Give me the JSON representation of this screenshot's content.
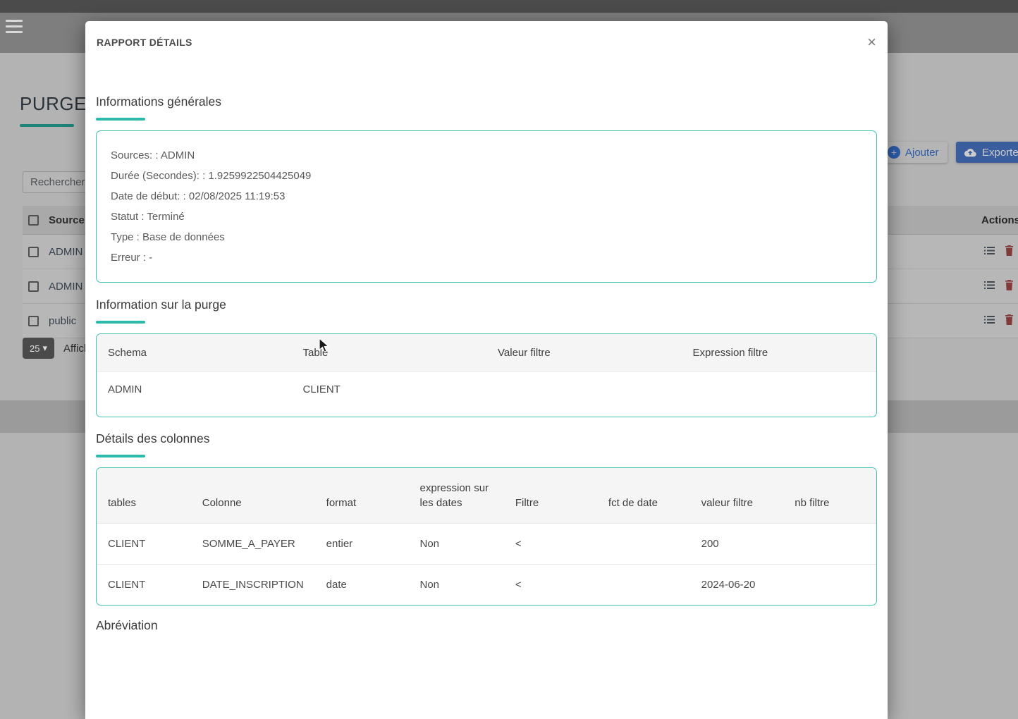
{
  "colors": {
    "accent_teal": "#2bbbad",
    "primary_blue": "#4285f4",
    "table_header_bg": "#f5f5f5"
  },
  "icons": {
    "menu": "hamburger",
    "close": "×",
    "add_plus": "+",
    "chevron_down": "▾",
    "export_cloud": "cloud-upload",
    "row_details": "list",
    "row_delete": "trash",
    "pointer": "mouse-cursor"
  },
  "background": {
    "page_title": "PURGE",
    "search_placeholder": "Rechercher",
    "toolbar": {
      "add_label": "Ajouter",
      "export_label": "Exporter"
    },
    "table": {
      "source_header": "Source",
      "actions_header": "Actions",
      "rows": [
        {
          "source": "ADMIN"
        },
        {
          "source": "ADMIN"
        },
        {
          "source": "public"
        }
      ]
    },
    "pagination": {
      "page_size": "25",
      "showing_label": "Affich"
    }
  },
  "modal": {
    "title": "RAPPORT DÉTAILS",
    "sections": {
      "general": {
        "title": "Informations générales",
        "lines": [
          "Sources:  : ADMIN",
          "Durée (Secondes):  : 1.9259922504425049",
          "Date de début:  : 02/08/2025 11:19:53",
          "Statut : Terminé",
          "Type : Base de données",
          "Erreur : -"
        ]
      },
      "purge": {
        "title": "Information sur la purge",
        "headers": [
          "Schema",
          "Table",
          "Valeur filtre",
          "Expression filtre"
        ],
        "rows": [
          [
            "ADMIN",
            "CLIENT",
            "",
            ""
          ]
        ]
      },
      "columns": {
        "title": "Détails des colonnes",
        "headers": [
          "tables",
          "Colonne",
          "format",
          "expression sur les dates",
          "Filtre",
          "fct de date",
          "valeur filtre",
          "nb filtre"
        ],
        "rows": [
          [
            "CLIENT",
            "SOMME_A_PAYER",
            "entier",
            "Non",
            "<",
            "",
            "200",
            ""
          ],
          [
            "CLIENT",
            "DATE_INSCRIPTION",
            "date",
            "Non",
            "<",
            "",
            "2024-06-20",
            ""
          ]
        ]
      },
      "abbreviation": {
        "title": "Abréviation"
      }
    }
  }
}
